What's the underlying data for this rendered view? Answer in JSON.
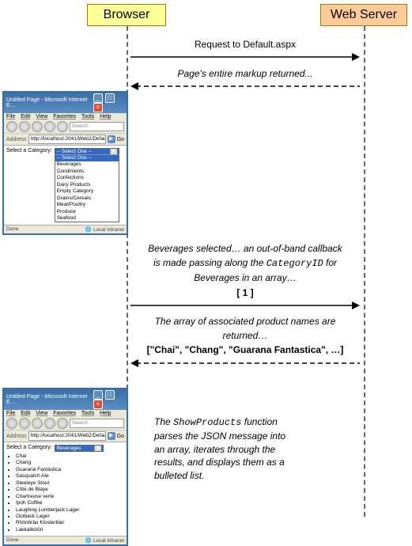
{
  "actors": {
    "browser": "Browser",
    "server": "Web Server"
  },
  "messages": {
    "req1": "Request to Default.aspx",
    "resp1": "Page's entire markup returned...",
    "req2_l1": "Beverages selected… an out-of-band callback",
    "req2_l2a": "is made passing along the ",
    "req2_l2b": "CategoryID",
    "req2_l2c": " for",
    "req2_l3": "Beverages in an array…",
    "req2_payload": "[ 1 ]",
    "resp2_l1": "The array of associated product names are",
    "resp2_l2": "returned…",
    "resp2_payload": "[\"Chai\", \"Chang\", \"Guarana Fantastica\", …]"
  },
  "note": {
    "l1a": "The ",
    "l1b": "ShowProducts",
    "l1c": " function",
    "l2": "parses the JSON message into",
    "l3": "an array, iterates through the",
    "l4": "results, and displays them as a",
    "l5": "bulleted list."
  },
  "mini": {
    "title": "Untitled Page - Microsoft Internet E…",
    "menu": {
      "file": "File",
      "edit": "Edit",
      "view": "View",
      "fav": "Favorites",
      "tools": "Tools",
      "help": "Help"
    },
    "search_placeholder": "Search",
    "addr_label": "Address",
    "addr_value": "http://localhost:2041/Web2/Default.aspx",
    "go": "Go",
    "label": "Select a Category:",
    "sel_placeholder": "-- Select One --",
    "options": [
      "Beverages",
      "Condiments",
      "Confections",
      "Dairy Products",
      "Empty Category",
      "Grains/Cereals",
      "Meat/Poultry",
      "Produce",
      "Seafood"
    ],
    "sel_value": "Beverages",
    "products": [
      "Chai",
      "Chang",
      "Guaraná Fantástica",
      "Sasquatch Ale",
      "Steeleye Stout",
      "Côte de Blaye",
      "Chartreuse verte",
      "Ipoh Coffee",
      "Laughing Lumberjack Lager",
      "Outback Lager",
      "Rhönbräu Klosterbier",
      "Lakkalikööri"
    ],
    "status_done": "Done",
    "status_zone": "Local intranet"
  }
}
